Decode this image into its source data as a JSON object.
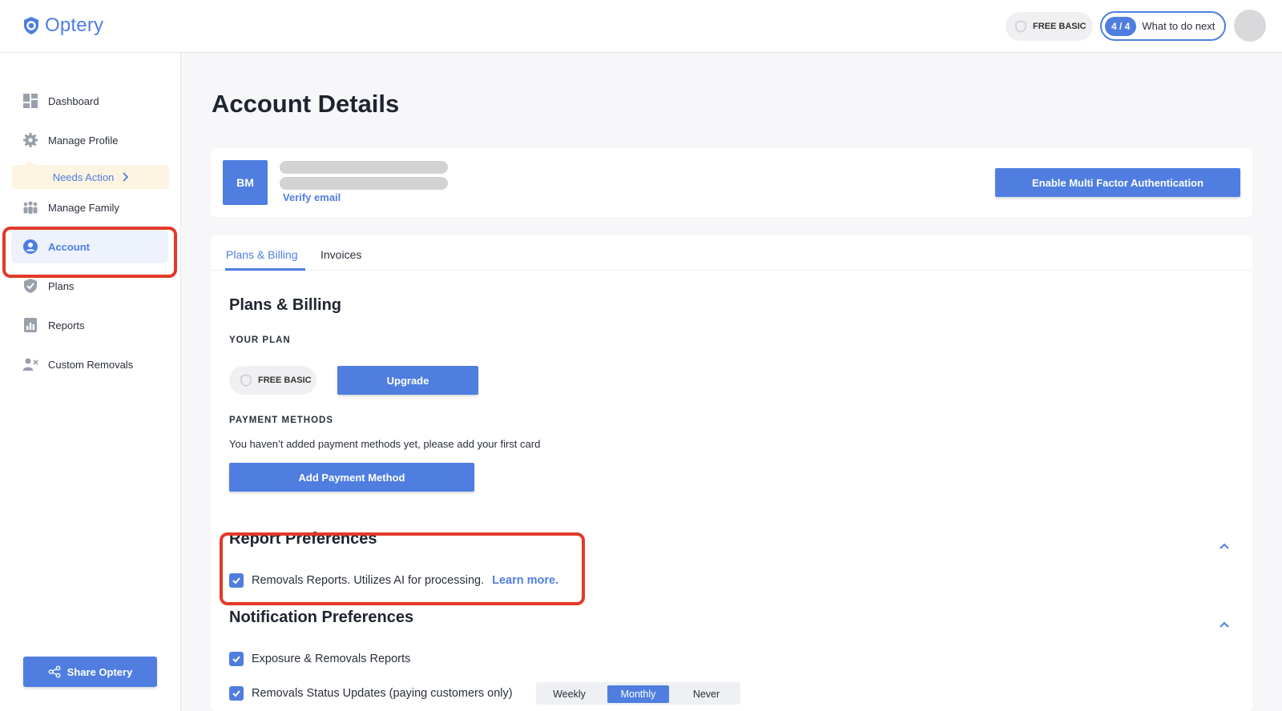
{
  "header": {
    "logo_text": "Optery",
    "plan_badge": "FREE BASIC",
    "progress_count": "4 / 4",
    "next_label": "What to do next"
  },
  "sidebar": {
    "items": [
      {
        "label": "Dashboard",
        "icon": "dashboard-icon"
      },
      {
        "label": "Manage Profile",
        "icon": "gear-icon"
      },
      {
        "label": "Manage Family",
        "icon": "family-icon"
      },
      {
        "label": "Account",
        "icon": "user-circle-icon",
        "active": true
      },
      {
        "label": "Plans",
        "icon": "shield-check-icon"
      },
      {
        "label": "Reports",
        "icon": "report-icon"
      },
      {
        "label": "Custom Removals",
        "icon": "user-remove-icon"
      }
    ],
    "needs_action": "Needs Action",
    "share_label": "Share Optery"
  },
  "main": {
    "title": "Account Details",
    "account": {
      "initials": "BM",
      "verify_email": "Verify email",
      "mfa_label": "Enable Multi Factor Authentication"
    },
    "tabs": [
      {
        "label": "Plans & Billing",
        "active": true
      },
      {
        "label": "Invoices",
        "active": false
      }
    ],
    "billing": {
      "title": "Plans & Billing",
      "your_plan_label": "YOUR PLAN",
      "plan_name": "FREE BASIC",
      "upgrade_label": "Upgrade",
      "payment_methods_label": "PAYMENT METHODS",
      "payment_note": "You haven’t added payment methods yet, please add your first card",
      "add_payment_label": "Add Payment Method"
    },
    "report_prefs": {
      "title": "Report Preferences",
      "option_label": "Removals Reports. Utilizes AI for processing.",
      "learn_more": "Learn more.",
      "checked": true
    },
    "notification_prefs": {
      "title": "Notification Preferences",
      "options": [
        {
          "label": "Exposure & Removals Reports",
          "checked": true
        },
        {
          "label": "Removals Status Updates (paying customers only)",
          "checked": true
        }
      ],
      "frequency": [
        "Weekly",
        "Monthly",
        "Never"
      ],
      "frequency_selected": "Monthly"
    }
  },
  "colors": {
    "accent": "#4f7ee0",
    "highlight": "#e23a2a",
    "needs_action_bg": "#fdf4e1"
  }
}
